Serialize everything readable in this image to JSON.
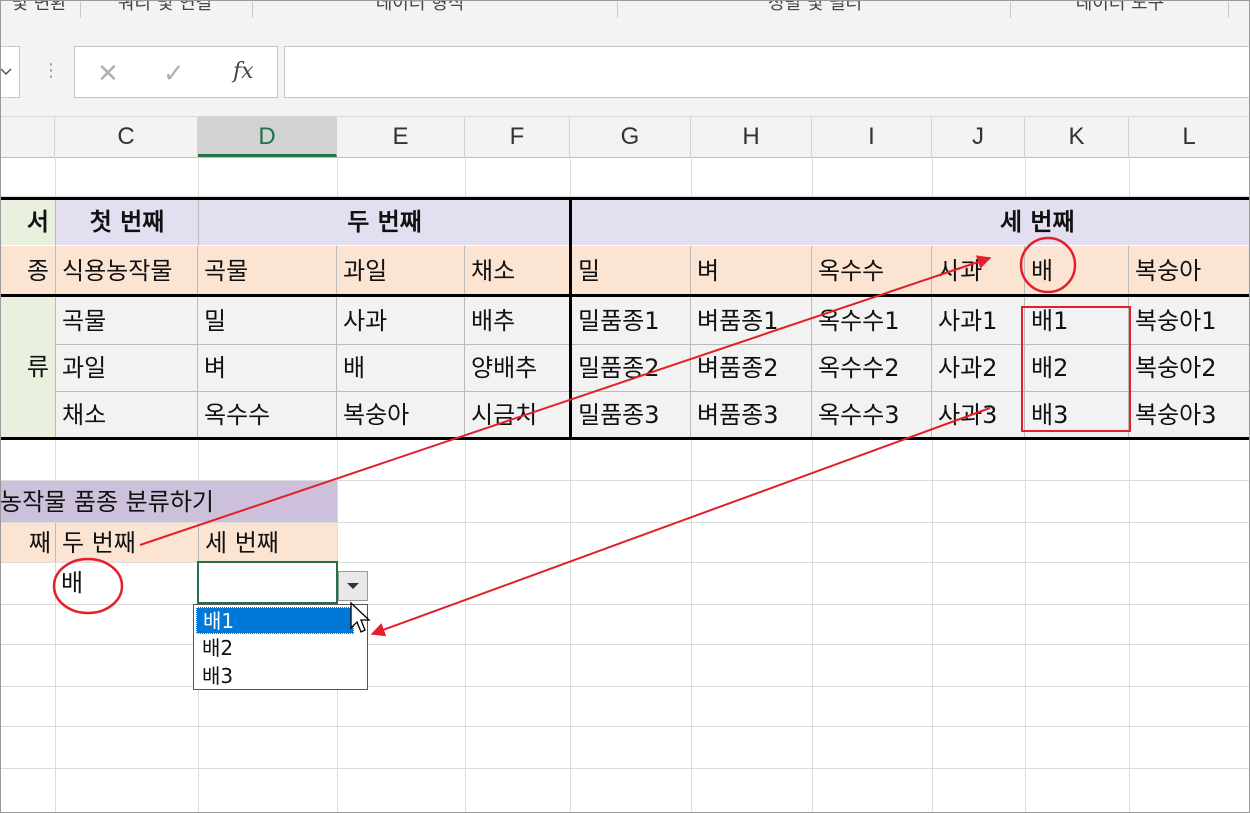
{
  "ribbon": {
    "groups": [
      "및 변환",
      "쿼리 및 연결",
      "데이터 형식",
      "정렬 및 필터",
      "데이터 도구"
    ]
  },
  "formula_bar": {
    "cancel_icon": "x-icon",
    "enter_icon": "check-icon",
    "function_label": "fx",
    "value": ""
  },
  "columns": {
    "selected": "D",
    "headers": [
      "C",
      "D",
      "E",
      "F",
      "G",
      "H",
      "I",
      "J",
      "K",
      "L"
    ]
  },
  "table": {
    "row1": {
      "b": "서",
      "c": "첫 번째",
      "d": "두 번째",
      "g": "세 번째"
    },
    "row2": [
      "종",
      "식용농작물",
      "곡물",
      "과일",
      "채소",
      "밀",
      "벼",
      "옥수수",
      "사과",
      "배",
      "복숭아"
    ],
    "row3": [
      "곡물",
      "밀",
      "사과",
      "배추",
      "밀품종1",
      "벼품종1",
      "옥수수1",
      "사과1",
      "배1",
      "복숭아1"
    ],
    "row4": [
      "과일",
      "벼",
      "배",
      "양배추",
      "밀품종2",
      "벼품종2",
      "옥수수2",
      "사과2",
      "배2",
      "복숭아2"
    ],
    "row5": [
      "채소",
      "옥수수",
      "복숭아",
      "시금치",
      "밀품종3",
      "벼품종3",
      "옥수수3",
      "사과3",
      "배3",
      "복숭아3"
    ],
    "b_label": "류"
  },
  "form": {
    "title": "농작물 품종 분류하기",
    "h_first": "째",
    "h_second": "두 번째",
    "h_third": "세 번째",
    "second_value": "배",
    "third_value": ""
  },
  "dropdown": {
    "options": [
      "배1",
      "배2",
      "배3"
    ],
    "selected_index": 0
  },
  "colors": {
    "header_purple": "#e4dff0",
    "header_peach": "#fce4d3",
    "label_green": "#e9f0de",
    "annotation_red": "#e3202a",
    "selection_blue": "#0078d7",
    "excel_green": "#217346"
  }
}
